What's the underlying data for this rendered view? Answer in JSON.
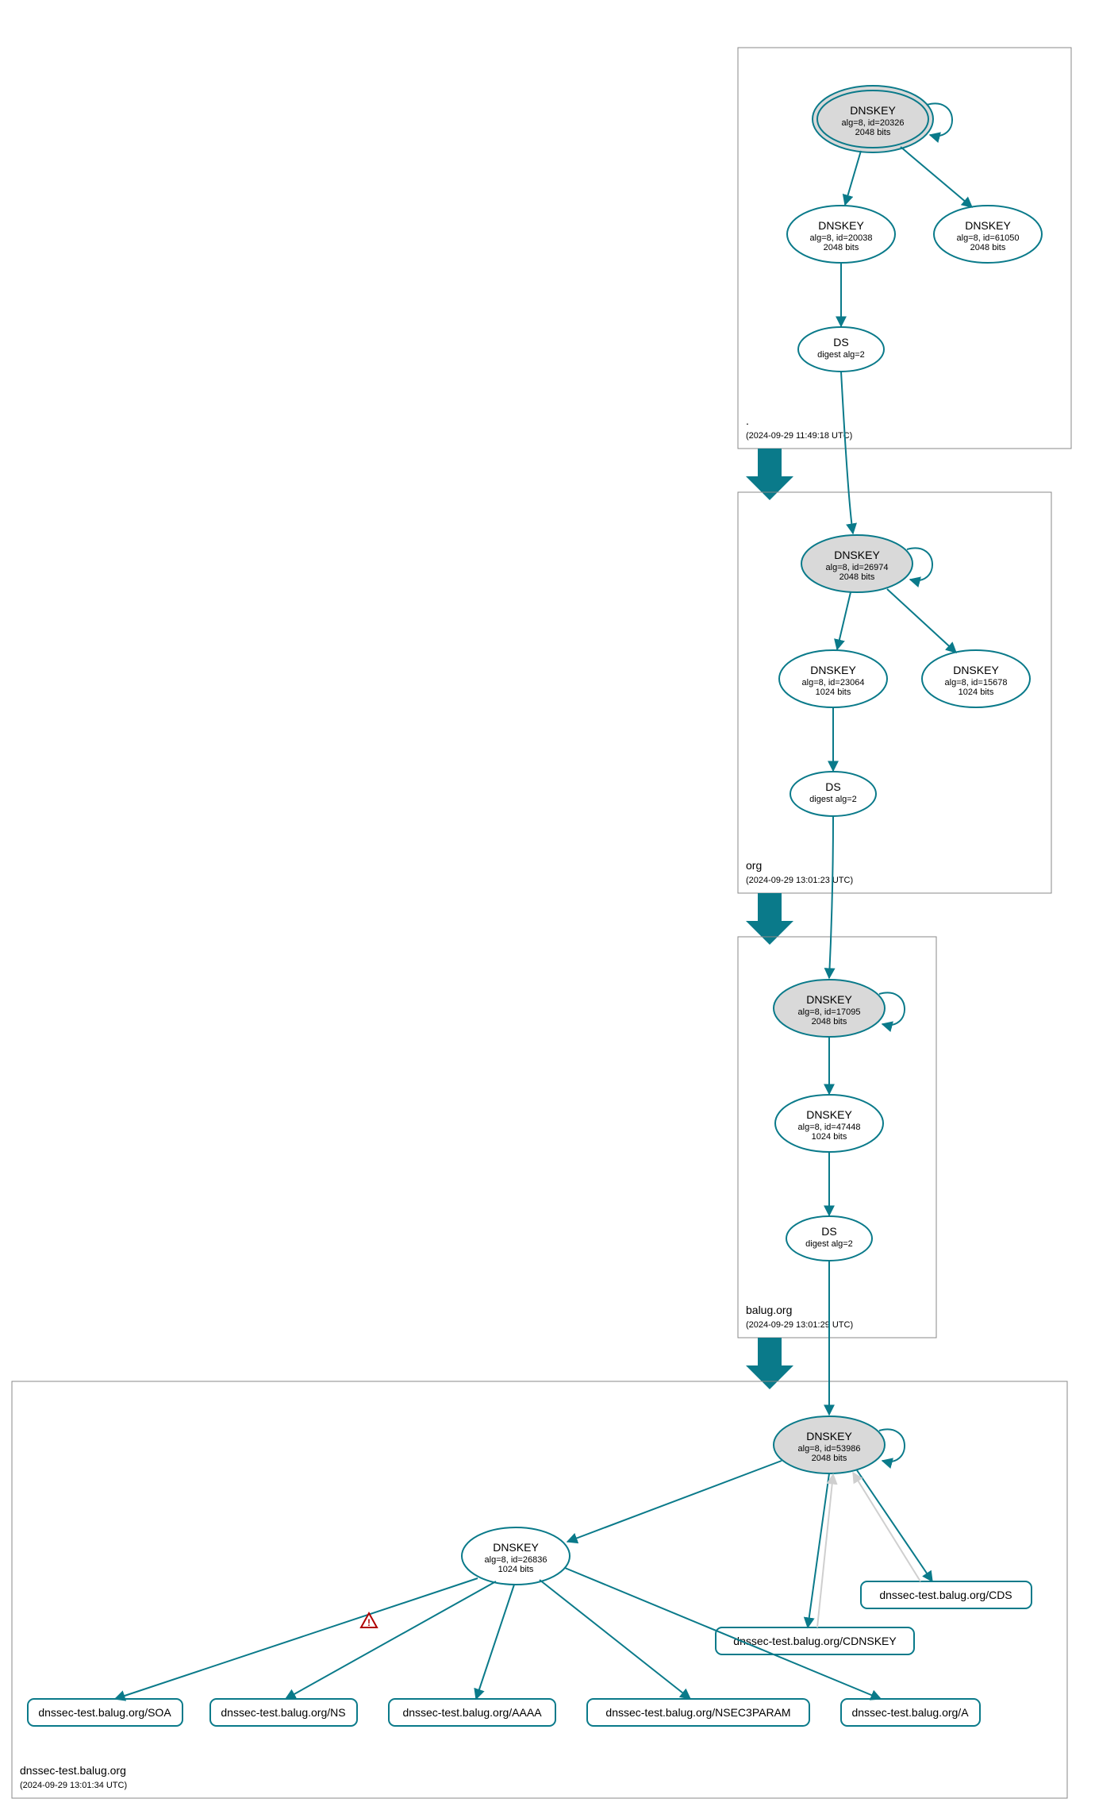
{
  "colors": {
    "edge": "#0a7a8a",
    "edge_light": "#cfcfcf",
    "node_fill_grey": "#d9d9d9",
    "node_fill_white": "#ffffff",
    "box_stroke": "#888888"
  },
  "zones": {
    "root": {
      "name": ".",
      "timestamp": "(2024-09-29 11:49:18 UTC)"
    },
    "org": {
      "name": "org",
      "timestamp": "(2024-09-29 13:01:23 UTC)"
    },
    "balug": {
      "name": "balug.org",
      "timestamp": "(2024-09-29 13:01:29 UTC)"
    },
    "dnssectest": {
      "name": "dnssec-test.balug.org",
      "timestamp": "(2024-09-29 13:01:34 UTC)"
    }
  },
  "nodes": {
    "root_ksk": {
      "title": "DNSKEY",
      "line1": "alg=8, id=20326",
      "line2": "2048 bits"
    },
    "root_zsk1": {
      "title": "DNSKEY",
      "line1": "alg=8, id=20038",
      "line2": "2048 bits"
    },
    "root_zsk2": {
      "title": "DNSKEY",
      "line1": "alg=8, id=61050",
      "line2": "2048 bits"
    },
    "root_ds": {
      "title": "DS",
      "line1": "digest alg=2"
    },
    "org_ksk": {
      "title": "DNSKEY",
      "line1": "alg=8, id=26974",
      "line2": "2048 bits"
    },
    "org_zsk1": {
      "title": "DNSKEY",
      "line1": "alg=8, id=23064",
      "line2": "1024 bits"
    },
    "org_zsk2": {
      "title": "DNSKEY",
      "line1": "alg=8, id=15678",
      "line2": "1024 bits"
    },
    "org_ds": {
      "title": "DS",
      "line1": "digest alg=2"
    },
    "balug_ksk": {
      "title": "DNSKEY",
      "line1": "alg=8, id=17095",
      "line2": "2048 bits"
    },
    "balug_zsk": {
      "title": "DNSKEY",
      "line1": "alg=8, id=47448",
      "line2": "1024 bits"
    },
    "balug_ds": {
      "title": "DS",
      "line1": "digest alg=2"
    },
    "dt_ksk": {
      "title": "DNSKEY",
      "line1": "alg=8, id=53986",
      "line2": "2048 bits"
    },
    "dt_zsk": {
      "title": "DNSKEY",
      "line1": "alg=8, id=26836",
      "line2": "1024 bits"
    },
    "dt_soa": {
      "label": "dnssec-test.balug.org/SOA"
    },
    "dt_ns": {
      "label": "dnssec-test.balug.org/NS"
    },
    "dt_aaaa": {
      "label": "dnssec-test.balug.org/AAAA"
    },
    "dt_nsec3param": {
      "label": "dnssec-test.balug.org/NSEC3PARAM"
    },
    "dt_a": {
      "label": "dnssec-test.balug.org/A"
    },
    "dt_cdnskey": {
      "label": "dnssec-test.balug.org/CDNSKEY"
    },
    "dt_cds": {
      "label": "dnssec-test.balug.org/CDS"
    }
  }
}
